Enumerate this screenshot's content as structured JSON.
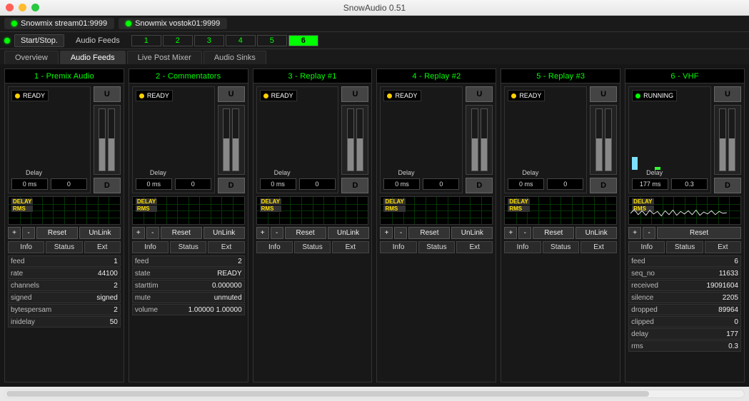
{
  "window": {
    "title": "SnowAudio 0.51"
  },
  "streams": [
    {
      "name": "Snowmix stream01:9999",
      "status": "on"
    },
    {
      "name": "Snowmix vostok01:9999",
      "status": "on"
    }
  ],
  "toolbar": {
    "start_stop": "Start/Stop.",
    "audio_feeds": "Audio Feeds",
    "channels": [
      "1",
      "2",
      "3",
      "4",
      "5",
      "6"
    ],
    "active_channel": 5
  },
  "main_tabs": {
    "overview": "Overview",
    "audio_feeds": "Audio Feeds",
    "live_post": "Live Post Mixer",
    "audio_sinks": "Audio Sinks",
    "active": "audio_feeds"
  },
  "panel_btns": {
    "plus": "+",
    "minus": "-",
    "reset": "Reset",
    "unlink": "UnLink",
    "u": "U",
    "d": "D"
  },
  "panel_tabs": {
    "info": "Info",
    "status": "Status",
    "ext": "Ext"
  },
  "graph_labels": {
    "delay": "DELAY",
    "rms": "RMS"
  },
  "panels": [
    {
      "title": "1 - Premix Audio",
      "status": "READY",
      "led": "y",
      "delay_label": "Delay",
      "delay_ms": "0 ms",
      "delay_val": "0",
      "meter_fill": [
        52,
        52
      ],
      "has_unlink": true,
      "has_wave": false,
      "info": [
        {
          "k": "feed",
          "v": "1"
        },
        {
          "k": "rate",
          "v": "44100"
        },
        {
          "k": "channels",
          "v": "2"
        },
        {
          "k": "signed",
          "v": "signed"
        },
        {
          "k": "bytespersam",
          "v": "2"
        },
        {
          "k": "inidelay",
          "v": "50"
        }
      ]
    },
    {
      "title": "2 - Commentators",
      "status": "READY",
      "led": "y",
      "delay_label": "Delay",
      "delay_ms": "0 ms",
      "delay_val": "0",
      "meter_fill": [
        52,
        52
      ],
      "has_unlink": true,
      "has_wave": false,
      "info": [
        {
          "k": "feed",
          "v": "2"
        },
        {
          "k": "state",
          "v": "READY"
        },
        {
          "k": "starttim",
          "v": "0.000000"
        },
        {
          "k": "mute",
          "v": "unmuted"
        },
        {
          "k": "volume",
          "v": "1.00000 1.00000"
        }
      ]
    },
    {
      "title": "3 - Replay #1",
      "status": "READY",
      "led": "y",
      "delay_label": "Delay",
      "delay_ms": "0 ms",
      "delay_val": "0",
      "meter_fill": [
        52,
        52
      ],
      "has_unlink": true,
      "has_wave": false,
      "info": []
    },
    {
      "title": "4 - Replay #2",
      "status": "READY",
      "led": "y",
      "delay_label": "Delay",
      "delay_ms": "0 ms",
      "delay_val": "0",
      "meter_fill": [
        52,
        52
      ],
      "has_unlink": true,
      "has_wave": false,
      "info": []
    },
    {
      "title": "5 - Replay #3",
      "status": "READY",
      "led": "y",
      "delay_label": "Delay",
      "delay_ms": "0 ms",
      "delay_val": "0",
      "meter_fill": [
        52,
        52
      ],
      "has_unlink": true,
      "has_wave": false,
      "info": []
    },
    {
      "title": "6 - VHF",
      "status": "RUNNING",
      "led": "g",
      "delay_label": "Delay",
      "delay_ms": "177 ms",
      "delay_val": "0.3",
      "meter_fill": [
        52,
        52
      ],
      "has_unlink": false,
      "has_wave": true,
      "running_vu": true,
      "info": [
        {
          "k": "feed",
          "v": "6"
        },
        {
          "k": "seq_no",
          "v": "11633"
        },
        {
          "k": "received",
          "v": "19091604"
        },
        {
          "k": "silence",
          "v": "2205"
        },
        {
          "k": "dropped",
          "v": "89964"
        },
        {
          "k": "clipped",
          "v": "0"
        },
        {
          "k": "delay",
          "v": "177"
        },
        {
          "k": "rms",
          "v": "0.3"
        }
      ]
    }
  ]
}
